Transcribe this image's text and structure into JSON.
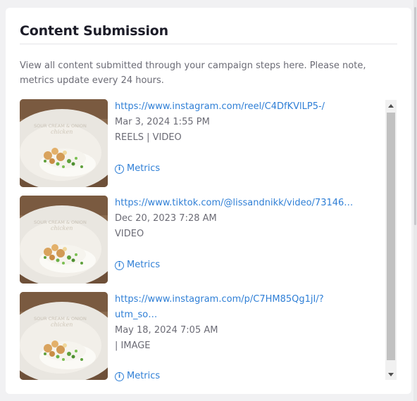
{
  "card": {
    "title": "Content Submission",
    "description": "View all content submitted through your campaign steps here. Please note, metrics update every 24 hours."
  },
  "submissions": [
    {
      "url": "https://www.instagram.com/reel/C4DfKVlLP5-/",
      "date": "Mar 3, 2024 1:55 PM",
      "type": "REELS | VIDEO",
      "metrics_label": "Metrics",
      "thumb_text_1": "SOUR CREAM & ONION",
      "thumb_text_2": "chicken"
    },
    {
      "url": "https://www.tiktok.com/@lissandnikk/video/73146…",
      "date": "Dec 20, 2023 7:28 AM",
      "type": "VIDEO",
      "metrics_label": "Metrics",
      "thumb_text_1": "SOUR CREAM & ONION",
      "thumb_text_2": "chicken"
    },
    {
      "url": "https://www.instagram.com/p/C7HM85Qg1jI/?utm_so…",
      "date": "May 18, 2024 7:05 AM",
      "type": "| IMAGE",
      "metrics_label": "Metrics",
      "thumb_text_1": "SOUR CREAM & ONION",
      "thumb_text_2": "chicken"
    }
  ],
  "icons": {
    "info": "info-circle-icon",
    "scroll_up": "triangle-up-icon",
    "scroll_down": "triangle-down-icon"
  },
  "colors": {
    "link": "#2f7fd6",
    "muted_text": "#6b6b75",
    "title": "#1c1c28"
  }
}
